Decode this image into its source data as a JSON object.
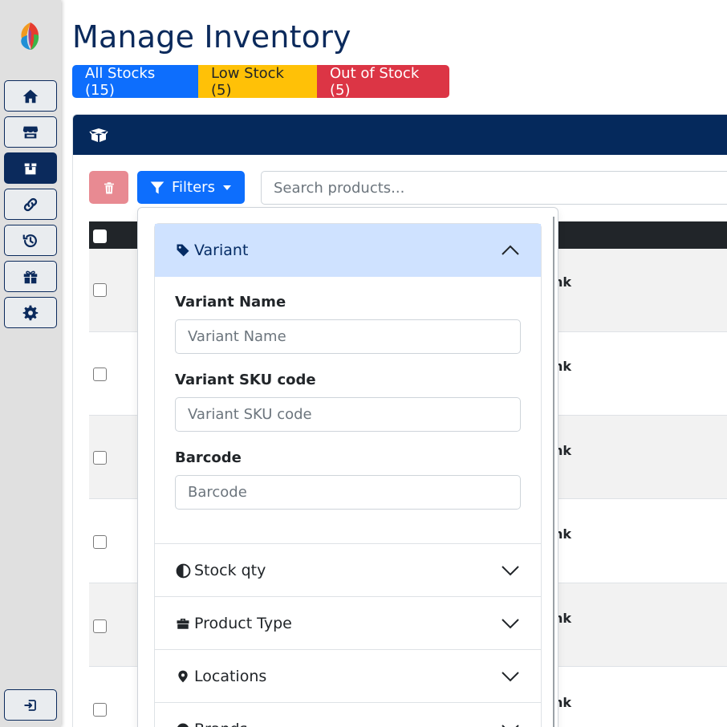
{
  "page": {
    "title": "Manage Inventory"
  },
  "colors": {
    "navy": "#0b2a5c",
    "primary": "#0d6efd",
    "warning": "#ffc107",
    "danger": "#dc3545",
    "accordion_active": "#cfe2ff"
  },
  "sidebar": {
    "items": [
      {
        "name": "home",
        "icon": "home-icon"
      },
      {
        "name": "store",
        "icon": "store-icon"
      },
      {
        "name": "inventory",
        "icon": "box-icon",
        "active": true
      },
      {
        "name": "links",
        "icon": "link-icon"
      },
      {
        "name": "history",
        "icon": "history-icon"
      },
      {
        "name": "gifts",
        "icon": "gift-icon"
      },
      {
        "name": "settings",
        "icon": "gear-icon"
      }
    ],
    "logout_icon": "sign-out-icon"
  },
  "tabs": [
    {
      "label": "All Stocks (15)"
    },
    {
      "label": "Low Stock (5)"
    },
    {
      "label": "Out of Stock (5)"
    }
  ],
  "toolbar": {
    "filters_label": "Filters",
    "search_placeholder": "Search products..."
  },
  "filters": {
    "sections": [
      {
        "label": "Variant",
        "icon": "tag-icon",
        "expanded": true,
        "fields": [
          {
            "label": "Variant Name",
            "placeholder": "Variant Name"
          },
          {
            "label": "Variant SKU code",
            "placeholder": "Variant SKU code"
          },
          {
            "label": "Barcode",
            "placeholder": "Barcode"
          }
        ]
      },
      {
        "label": "Stock qty",
        "icon": "half-circle-icon",
        "expanded": false
      },
      {
        "label": "Product Type",
        "icon": "briefcase-icon",
        "expanded": false
      },
      {
        "label": "Locations",
        "icon": "map-pin-icon",
        "expanded": false
      },
      {
        "label": "Brands",
        "icon": "badge-icon",
        "expanded": false
      }
    ]
  },
  "table": {
    "rows": [
      {
        "text": "nk"
      },
      {
        "text": "nk"
      },
      {
        "text": "nk"
      },
      {
        "text": "nk"
      },
      {
        "text": "nk"
      },
      {
        "text": "nk"
      }
    ]
  }
}
